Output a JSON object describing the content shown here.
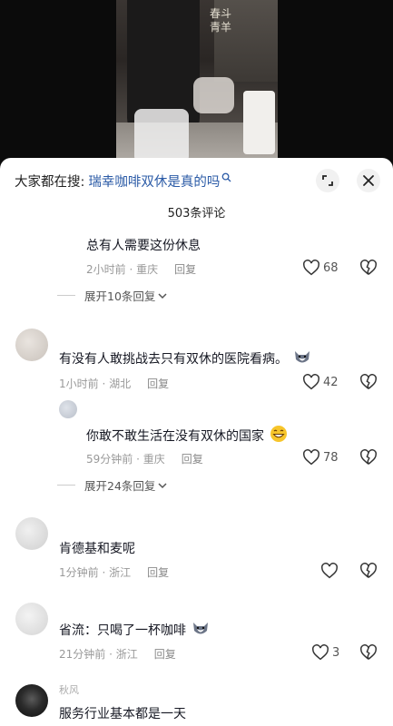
{
  "video": {
    "logo_text": "春斗\n青羊"
  },
  "header": {
    "search_prefix": "大家都在搜:",
    "search_term": "瑞幸咖啡双休是真的吗"
  },
  "comment_count": "503条评论",
  "comments": [
    {
      "text": "总有人需要这份休息",
      "time": "2小时前 · 重庆",
      "reply": "回复",
      "likes": "68",
      "expand": "展开10条回复"
    },
    {
      "username": "",
      "text": "有没有人敢挑战去只有双休的医院看病。",
      "emoji": "husky",
      "time": "1小时前 · 湖北",
      "reply": "回复",
      "likes": "42"
    },
    {
      "username": "",
      "text": "你敢不敢生活在没有双休的国家",
      "emoji": "grin",
      "time": "59分钟前 · 重庆",
      "reply": "回复",
      "likes": "78",
      "expand": "展开24条回复"
    },
    {
      "username": "",
      "text": "肯德基和麦呢",
      "time": "1分钟前 · 浙江",
      "reply": "回复",
      "likes": ""
    },
    {
      "username": "",
      "text": "省流：只喝了一杯咖啡",
      "emoji": "husky",
      "time": "21分钟前 · 浙江",
      "reply": "回复",
      "likes": "3"
    },
    {
      "username": "秋风",
      "text": "服务行业基本都是一天"
    }
  ],
  "icons": {
    "search": "search-icon",
    "expand": "expand-icon",
    "close": "close-icon",
    "like": "heart-icon",
    "dislike": "broken-heart-icon",
    "chevron": "chevron-down-icon"
  }
}
